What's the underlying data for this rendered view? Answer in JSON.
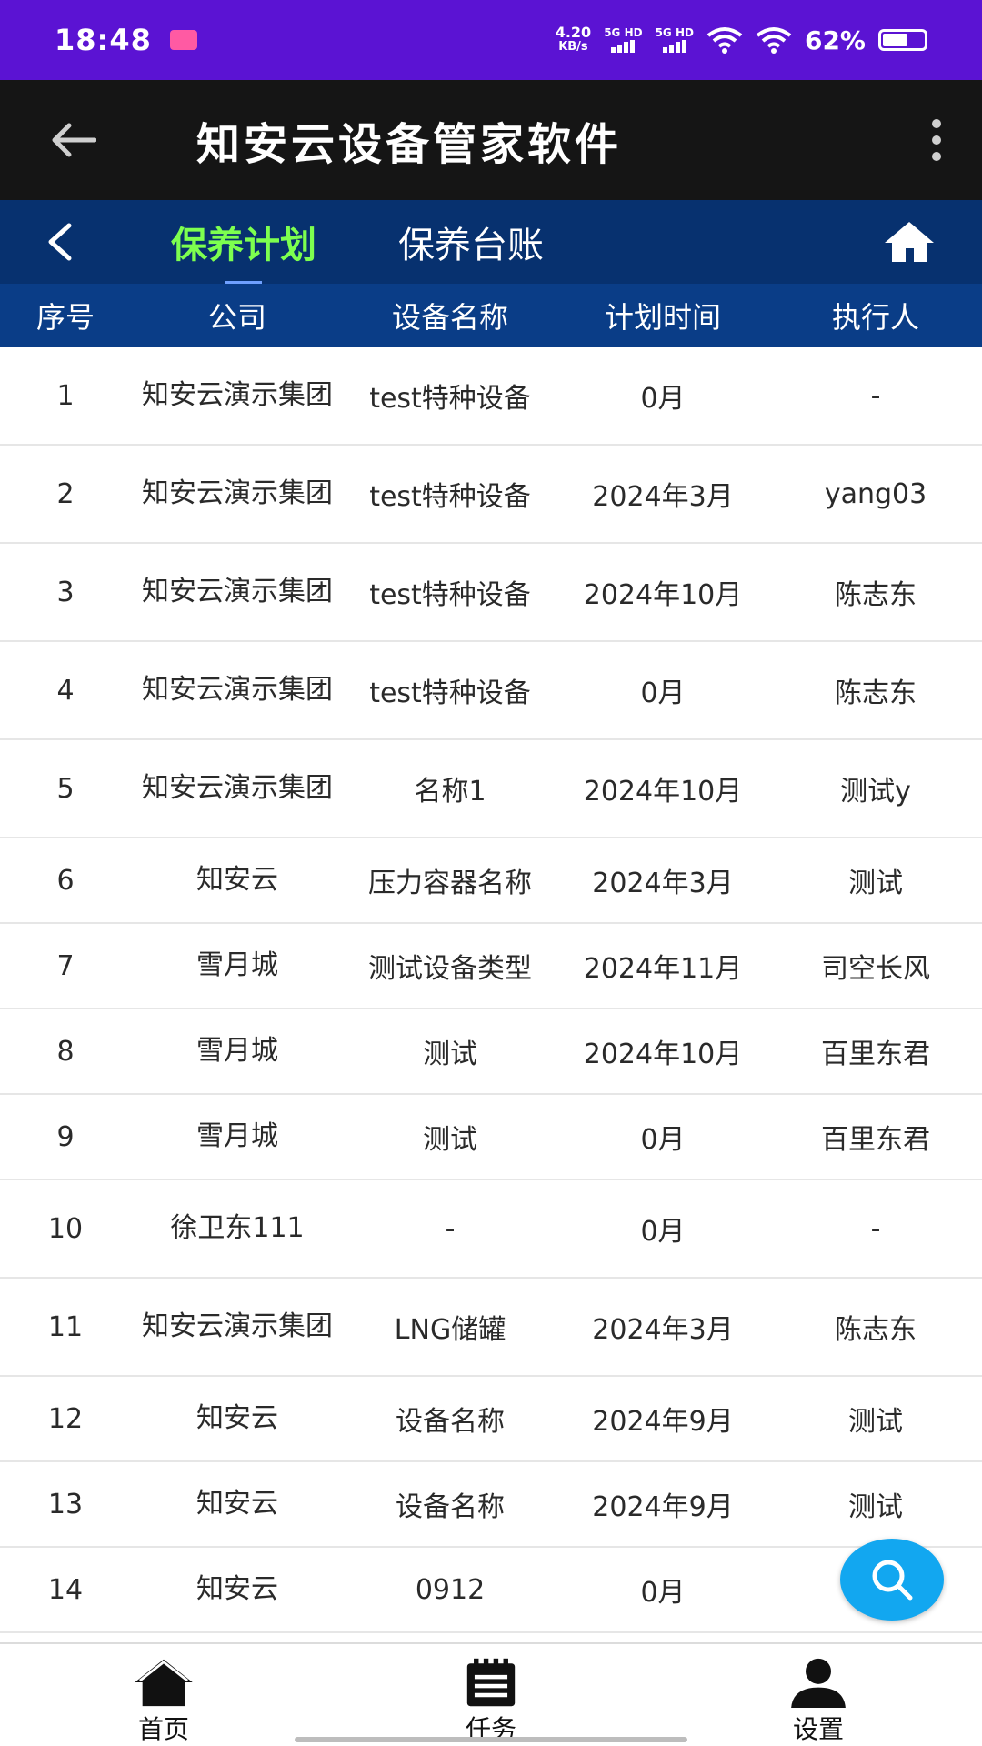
{
  "status_bar": {
    "time": "18:48",
    "net_speed_value": "4.20",
    "net_speed_unit": "KB/s",
    "sim1": "5G HD",
    "sim2": "5G HD",
    "battery_percent": "62%",
    "battery_level": 0.62,
    "icons": [
      "app-notification-icon",
      "signal-icon",
      "wifi-icon",
      "battery-icon"
    ]
  },
  "app_bar": {
    "title": "知安云设备管家软件",
    "icons": [
      "back-arrow-icon",
      "more-vert-icon"
    ]
  },
  "tabs": {
    "items": [
      {
        "label": "保养计划",
        "active": true
      },
      {
        "label": "保养台账",
        "active": false
      }
    ],
    "icons": [
      "chevron-left-icon",
      "home-icon"
    ]
  },
  "table": {
    "headers": [
      "序号",
      "公司",
      "设备名称",
      "计划时间",
      "执行人"
    ],
    "rows": [
      [
        "1",
        "知安云演示集团",
        "test特种设备",
        "0月",
        "-"
      ],
      [
        "2",
        "知安云演示集团",
        "test特种设备",
        "2024年3月",
        "yang03"
      ],
      [
        "3",
        "知安云演示集团",
        "test特种设备",
        "2024年10月",
        "陈志东"
      ],
      [
        "4",
        "知安云演示集团",
        "test特种设备",
        "0月",
        "陈志东"
      ],
      [
        "5",
        "知安云演示集团",
        "名称1",
        "2024年10月",
        "测试y"
      ],
      [
        "6",
        "知安云",
        "压力容器名称",
        "2024年3月",
        "测试"
      ],
      [
        "7",
        "雪月城",
        "测试设备类型",
        "2024年11月",
        "司空长风"
      ],
      [
        "8",
        "雪月城",
        "测试",
        "2024年10月",
        "百里东君"
      ],
      [
        "9",
        "雪月城",
        "测试",
        "0月",
        "百里东君"
      ],
      [
        "10",
        "徐卫东111",
        "-",
        "0月",
        "-"
      ],
      [
        "11",
        "知安云演示集团",
        "LNG储罐",
        "2024年3月",
        "陈志东"
      ],
      [
        "12",
        "知安云",
        "设备名称",
        "2024年9月",
        "测试"
      ],
      [
        "13",
        "知安云",
        "设备名称",
        "2024年9月",
        "测试"
      ],
      [
        "14",
        "知安云",
        "0912",
        "0月",
        ""
      ]
    ]
  },
  "fab": {
    "icon": "search-icon"
  },
  "bottom_nav": {
    "items": [
      {
        "label": "首页",
        "icon": "home-icon"
      },
      {
        "label": "任务",
        "icon": "task-list-icon"
      },
      {
        "label": "设置",
        "icon": "user-icon"
      }
    ]
  },
  "colors": {
    "status_bar": "#5b13d3",
    "app_bar": "#151515",
    "tab_bar": "#07316f",
    "table_header": "#0a3d87",
    "active_tab": "#7dff4f",
    "fab": "#12a7f0"
  }
}
